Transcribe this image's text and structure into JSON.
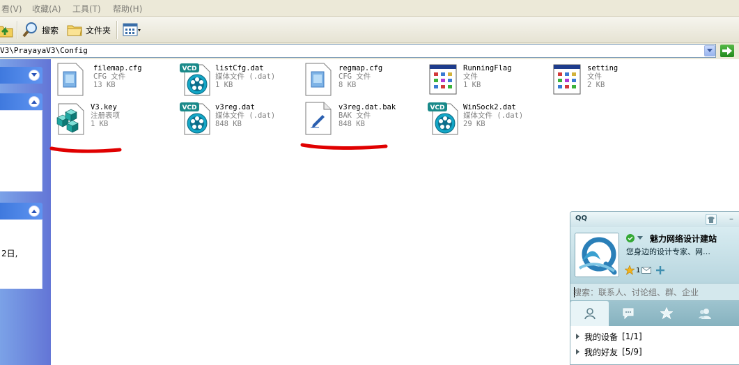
{
  "menubar": {
    "items": [
      {
        "label": "看(V)"
      },
      {
        "label": "收藏(A)"
      },
      {
        "label": "工具(T)"
      },
      {
        "label": "帮助(H)"
      }
    ]
  },
  "toolbar": {
    "search_label": "搜索",
    "folders_label": "文件夹"
  },
  "address": {
    "path": "V3\\PrayayaV3\\Config"
  },
  "leftpane": {
    "partial_text": "2日,"
  },
  "files": [
    {
      "name": "filemap.cfg",
      "type": "CFG 文件",
      "size": "13 KB",
      "icon": "cfg-file-icon"
    },
    {
      "name": "listCfg.dat",
      "type": "媒体文件 (.dat)",
      "size": "1 KB",
      "icon": "vcd-media-icon"
    },
    {
      "name": "regmap.cfg",
      "type": "CFG 文件",
      "size": "8 KB",
      "icon": "cfg-file-icon"
    },
    {
      "name": "RunningFlag",
      "type": "文件",
      "size": "1 KB",
      "icon": "generic-window-file-icon"
    },
    {
      "name": "setting",
      "type": "文件",
      "size": "2 KB",
      "icon": "generic-window-file-icon"
    },
    {
      "name": "V3.key",
      "type": "注册表项",
      "size": "1 KB",
      "icon": "registry-cubes-icon"
    },
    {
      "name": "v3reg.dat",
      "type": "媒体文件 (.dat)",
      "size": "848 KB",
      "icon": "vcd-media-icon"
    },
    {
      "name": "v3reg.dat.bak",
      "type": "BAK 文件",
      "size": "848 KB",
      "icon": "bak-file-icon"
    },
    {
      "name": "WinSock2.dat",
      "type": "媒体文件 (.dat)",
      "size": "29 KB",
      "icon": "vcd-media-icon"
    }
  ],
  "vcd_badge": "VCD",
  "qq": {
    "title": "QQ",
    "nickname": "魅力网络设计建站",
    "signature": "您身边的设计专家、网…",
    "level": "1",
    "search_placeholder": "搜索：联系人、讨论组、群、企业",
    "groups": [
      {
        "name": "我的设备",
        "count": "[1/1]"
      },
      {
        "name": "我的好友",
        "count": "[5/9]"
      }
    ],
    "colors": {
      "online": "#34a834",
      "accent": "#b9d7e0"
    }
  },
  "colors": {
    "menubar": "#ece9d8",
    "taskpane": "#6375d6",
    "annotation": "#e00000"
  }
}
